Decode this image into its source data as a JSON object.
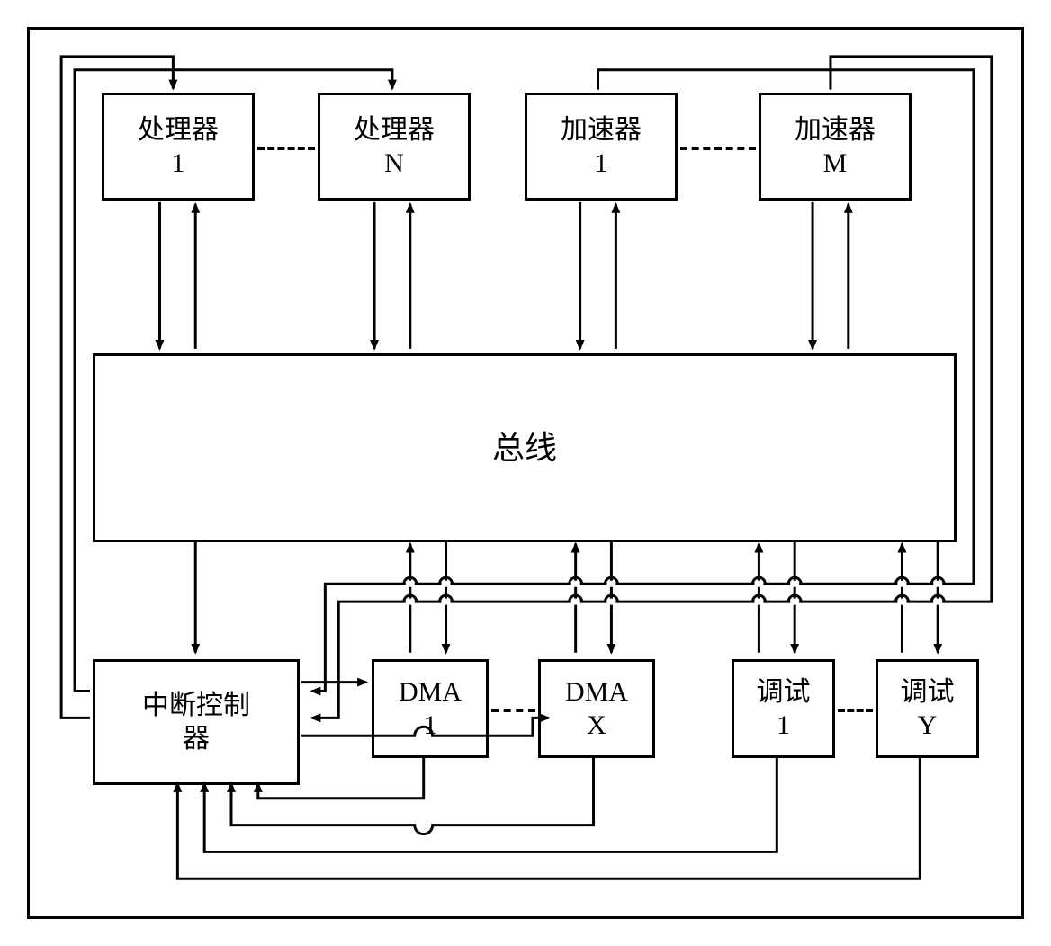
{
  "blocks": {
    "processor1": {
      "line1": "处理器",
      "line2": "1"
    },
    "processorN": {
      "line1": "处理器",
      "line2": "N"
    },
    "accelerator1": {
      "line1": "加速器",
      "line2": "1"
    },
    "acceleratorM": {
      "line1": "加速器",
      "line2": "M"
    },
    "bus": {
      "line1": "总线"
    },
    "intController": {
      "line1": "中断控制",
      "line2": "器"
    },
    "dma1": {
      "line1": "DMA",
      "line2": "1"
    },
    "dmaX": {
      "line1": "DMA",
      "line2": "X"
    },
    "debug1": {
      "line1": "调试",
      "line2": "1"
    },
    "debugY": {
      "line1": "调试",
      "line2": "Y"
    }
  }
}
